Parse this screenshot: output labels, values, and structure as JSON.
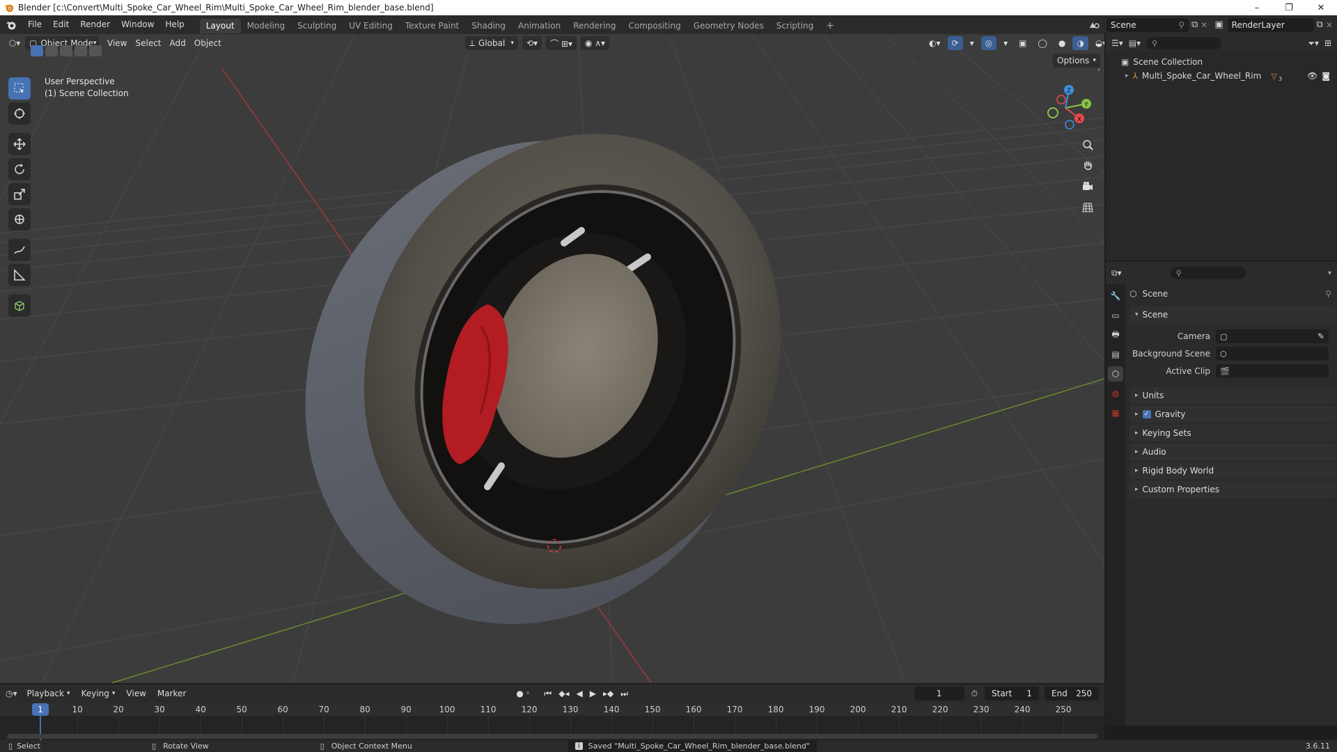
{
  "window": {
    "title": "Blender [c:\\Convert\\Multi_Spoke_Car_Wheel_Rim\\Multi_Spoke_Car_Wheel_Rim_blender_base.blend]",
    "minimize": "–",
    "maximize": "❐",
    "close": "✕"
  },
  "menu": {
    "items": [
      "File",
      "Edit",
      "Render",
      "Window",
      "Help"
    ]
  },
  "workspaces": [
    "Layout",
    "Modeling",
    "Sculpting",
    "UV Editing",
    "Texture Paint",
    "Shading",
    "Animation",
    "Rendering",
    "Compositing",
    "Geometry Nodes",
    "Scripting"
  ],
  "workspace_add": "+",
  "scene_selector": {
    "value": "Scene"
  },
  "view_layer_selector": {
    "value": "RenderLayer"
  },
  "viewport": {
    "mode": "Object Mode",
    "menus": [
      "View",
      "Select",
      "Add",
      "Object"
    ],
    "transform_orientation": "Global",
    "options_label": "Options",
    "overlay_title": "User Perspective",
    "overlay_subtitle": "(1) Scene Collection",
    "gizmo_axes": {
      "x": "X",
      "y": "Y",
      "z": "Z"
    }
  },
  "outliner": {
    "root": "Scene Collection",
    "items": [
      {
        "name": "Multi_Spoke_Car_Wheel_Rim",
        "badge": "3"
      }
    ]
  },
  "properties": {
    "context_title": "Scene",
    "scene_panel": {
      "title": "Scene",
      "rows": [
        {
          "label": "Camera",
          "value": ""
        },
        {
          "label": "Background Scene",
          "value": ""
        },
        {
          "label": "Active Clip",
          "value": ""
        }
      ]
    },
    "collapsed_panels": [
      {
        "title": "Units",
        "checkbox": false
      },
      {
        "title": "Gravity",
        "checkbox": true
      },
      {
        "title": "Keying Sets",
        "checkbox": false
      },
      {
        "title": "Audio",
        "checkbox": false
      },
      {
        "title": "Rigid Body World",
        "checkbox": false
      },
      {
        "title": "Custom Properties",
        "checkbox": false
      }
    ]
  },
  "timeline": {
    "menus": [
      "Playback",
      "Keying",
      "View",
      "Marker"
    ],
    "current_frame": "1",
    "start_label": "Start",
    "start": "1",
    "end_label": "End",
    "end": "250",
    "ruler_current": "1",
    "ruler_labels": [
      "10",
      "20",
      "30",
      "40",
      "50",
      "60",
      "70",
      "80",
      "90",
      "100",
      "110",
      "120",
      "130",
      "140",
      "150",
      "160",
      "170",
      "180",
      "190",
      "200",
      "210",
      "220",
      "230",
      "240",
      "250"
    ]
  },
  "statusbar": {
    "select": "Select",
    "rotate": "Rotate View",
    "context_menu": "Object Context Menu",
    "message": "Saved \"Multi_Spoke_Car_Wheel_Rim_blender_base.blend\"",
    "version": "3.6.11"
  },
  "colors": {
    "accent": "#4772b3",
    "x_axis": "#e8484e",
    "y_axis": "#8bc34a",
    "z_axis": "#3f8fe0",
    "caliper": "#b31c22"
  }
}
